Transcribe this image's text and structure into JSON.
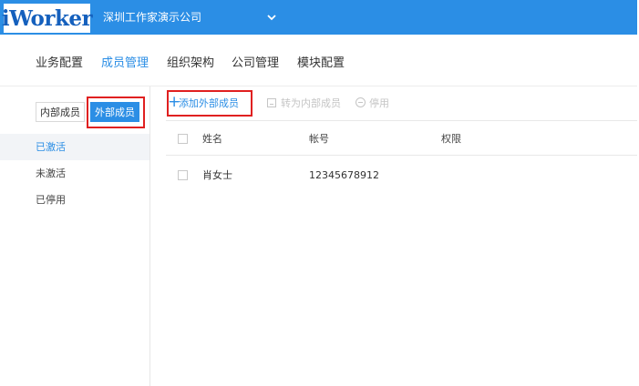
{
  "header": {
    "logo_text": "iWorker",
    "company_name": "深圳工作家演示公司",
    "bg_color": "#2b8ee5"
  },
  "main_nav": {
    "items": [
      {
        "label": "业务配置",
        "active": false
      },
      {
        "label": "成员管理",
        "active": true
      },
      {
        "label": "组织架构",
        "active": false
      },
      {
        "label": "公司管理",
        "active": false
      },
      {
        "label": "模块配置",
        "active": false
      }
    ]
  },
  "sidebar": {
    "segments": {
      "internal": "内部成员",
      "external": "外部成员"
    },
    "items": [
      {
        "label": "已激活",
        "active": true
      },
      {
        "label": "未激活",
        "active": false
      },
      {
        "label": "已停用",
        "active": false
      }
    ]
  },
  "toolbar": {
    "add_label": "添加外部成员",
    "convert_label": "转为内部成员",
    "disable_label": "停用"
  },
  "table": {
    "columns": [
      "姓名",
      "帐号",
      "权限"
    ],
    "rows": [
      {
        "name": "肖女士",
        "account": "12345678912",
        "permission": ""
      }
    ]
  },
  "colors": {
    "accent": "#2b8ee5",
    "highlight_box": "#e02020"
  },
  "icons": {
    "company_dropdown": "chevron-down-icon",
    "add": "plus-icon",
    "convert": "convert-icon",
    "disable": "disable-icon"
  }
}
